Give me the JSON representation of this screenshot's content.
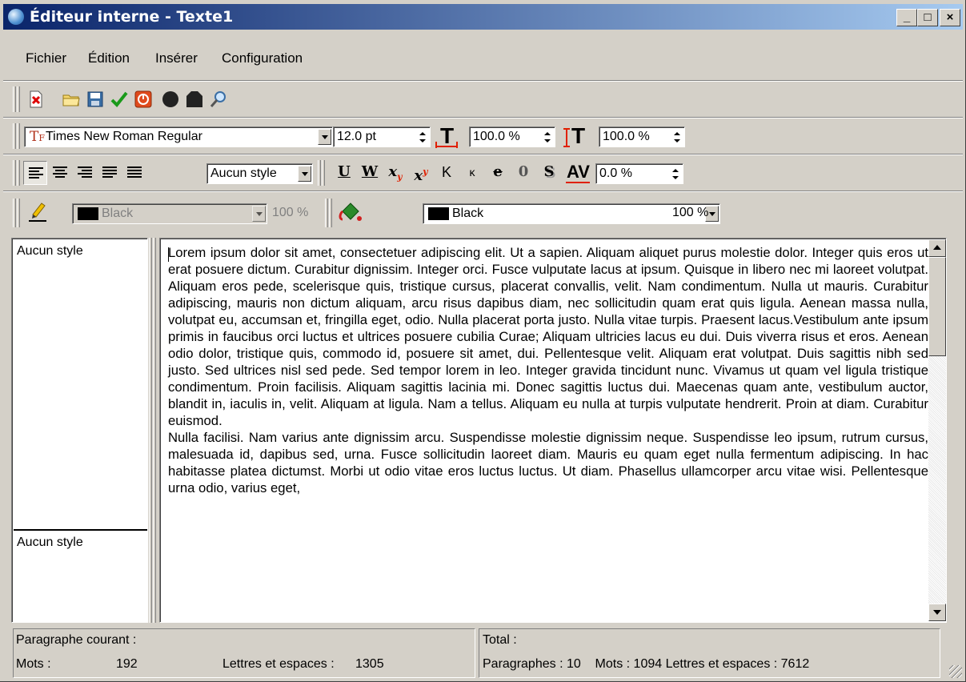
{
  "window": {
    "title": "Éditeur interne - Texte1",
    "caption_buttons": [
      "_",
      "□",
      "×"
    ]
  },
  "menu": [
    "Fichier",
    "Édition",
    "Insérer",
    "Configuration"
  ],
  "toolbar_main": {
    "icons": [
      "close-document-icon",
      "open-folder-icon",
      "save-icon",
      "check-icon",
      "power-icon",
      "record-icon",
      "stop-icon",
      "search-icon"
    ]
  },
  "toolbar_font": {
    "font_name": "Times New Roman Regular",
    "size": "12.0 pt",
    "width_scale": "100.0 %",
    "height_scale": "100.0 %"
  },
  "toolbar_format": {
    "paragraph_style": "Aucun style",
    "buttons": [
      "U",
      "W",
      "x",
      "x",
      "K",
      "κ",
      "e",
      "0",
      "S"
    ],
    "spacing": "0.0 %"
  },
  "toolbar_color": {
    "text_color": "Black",
    "text_opacity": "100 %",
    "fill_color": "Black",
    "fill_opacity": "100 %",
    "swatch": "#000000"
  },
  "styles_pane": {
    "items": [
      "Aucun style",
      "Aucun style"
    ]
  },
  "editor": {
    "paragraphs": [
      "Lorem ipsum dolor sit amet, consectetuer adipiscing elit. Ut a sapien. Aliquam aliquet purus molestie dolor. Integer quis eros ut erat posuere dictum. Curabitur dignissim. Integer orci. Fusce vulputate lacus at ipsum. Quisque in libero nec mi laoreet volutpat. Aliquam eros pede, scelerisque quis, tristique cursus, placerat convallis, velit. Nam condimentum. Nulla ut mauris. Curabitur adipiscing, mauris non dictum aliquam, arcu risus dapibus diam, nec sollicitudin quam erat quis ligula. Aenean massa nulla, volutpat eu, accumsan et, fringilla eget, odio. Nulla placerat porta justo. Nulla vitae turpis. Praesent lacus.Vestibulum ante ipsum primis in faucibus orci luctus et ultrices posuere cubilia Curae; Aliquam ultricies lacus eu dui. Duis viverra risus et eros. Aenean odio dolor, tristique quis, commodo id, posuere sit amet, dui. Pellentesque velit. Aliquam erat volutpat. Duis sagittis nibh sed justo. Sed ultrices nisl sed pede. Sed tempor lorem in leo. Integer gravida tincidunt nunc. Vivamus ut quam vel ligula tristique condimentum. Proin facilisis. Aliquam sagittis lacinia mi. Donec sagittis luctus dui. Maecenas quam ante, vestibulum auctor, blandit in, iaculis in, velit. Aliquam at ligula. Nam a tellus. Aliquam eu nulla at turpis vulputate hendrerit. Proin at diam. Curabitur euismod.",
      "Nulla facilisi. Nam varius ante dignissim arcu. Suspendisse molestie dignissim neque. Suspendisse leo ipsum, rutrum cursus, malesuada id, dapibus sed, urna. Fusce sollicitudin laoreet diam. Mauris eu quam eget nulla fermentum adipiscing. In hac habitasse platea dictumst. Morbi ut odio vitae eros luctus luctus. Ut diam. Phasellus ullamcorper arcu vitae wisi. Pellentesque urna odio, varius eget,"
    ]
  },
  "status": {
    "current_label": "Paragraphe courant :",
    "words_label": "Mots :",
    "words_value": "192",
    "letters_label": "Lettres et espaces :",
    "letters_value": "1305",
    "total_label": "Total :",
    "total_line": "Paragraphes : 10    Mots : 1094 Lettres et espaces : 7612"
  }
}
